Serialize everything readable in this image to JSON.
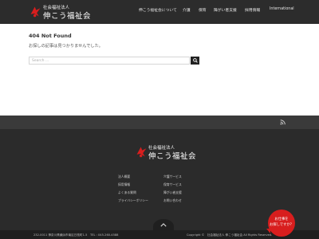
{
  "header": {
    "logo_sub": "社会福祉法人",
    "logo_main": "伸こう福祉会",
    "nav": [
      "伸こう福祉会について",
      "介護",
      "保育",
      "障がい者支援",
      "採用情報",
      "International"
    ]
  },
  "main": {
    "title": "404 Not Found",
    "message": "お探しの記事は見つかりませんでした。",
    "search_placeholder": "Search ..."
  },
  "footer": {
    "logo_sub": "社会福祉法人",
    "logo_main": "伸こう福祉会",
    "links_left": [
      "法人概要",
      "採用情報",
      "よくある質問",
      "プライバシーポリシー"
    ],
    "links_right": [
      "介護サービス",
      "保育サービス",
      "障がい者支援",
      "お問い合わせ"
    ],
    "address": "232-0011 神奈川県横浜市南区日枝町1-5　TEL : 045-260-4588",
    "copyright": "Copyright ©　社会福祉法人 伸こう福祉会 All Rights Reserved."
  },
  "contact_button": {
    "line1": "お仕事を",
    "line2": "お探しですか？"
  },
  "colors": {
    "header_bg": "#2c2c2c",
    "footer_bg": "#2b2b2b",
    "brand_red": "#d81e1e"
  },
  "icons": [
    "logo-mark-icon",
    "search-icon",
    "rss-icon",
    "chevron-up-icon"
  ]
}
